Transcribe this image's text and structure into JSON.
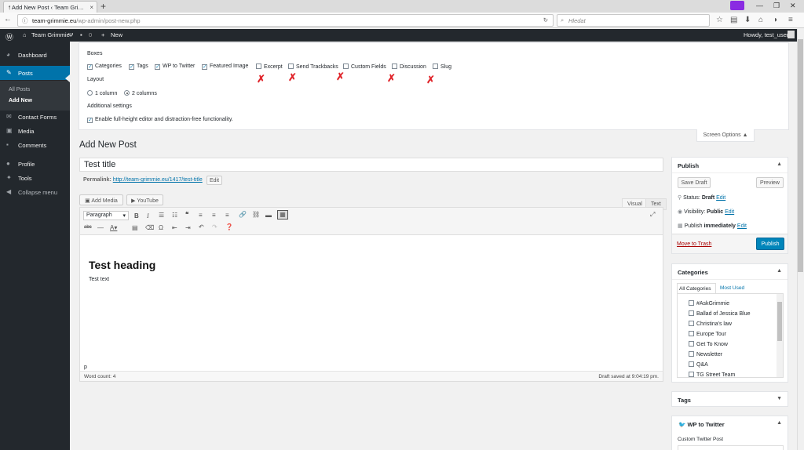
{
  "browser": {
    "tab_title": "Add New Post ‹ Team Gri…",
    "tab_close": "×",
    "new_tab": "+",
    "url_domain": "team-grimmie.eu",
    "url_path": "/wp-admin/post-new.php",
    "search_placeholder": "Hledat",
    "icons": [
      "back-icon",
      "info-icon",
      "reload-icon",
      "bookmark-star-icon",
      "reading-list-icon",
      "download-icon",
      "home-icon",
      "pocket-icon",
      "menu-icon",
      "private-mask-icon"
    ]
  },
  "admin_bar": {
    "site_name": "Team Grimmie",
    "comments_count": "0",
    "new_label": "New",
    "greeting": "Howdy, test_user"
  },
  "sidebar": {
    "items": [
      {
        "label": "Dashboard",
        "icon": "dashboard-icon"
      },
      {
        "label": "Posts",
        "icon": "pin-icon"
      },
      {
        "label": "Contact Forms",
        "icon": "mail-icon"
      },
      {
        "label": "Media",
        "icon": "media-icon"
      },
      {
        "label": "Comments",
        "icon": "comment-icon"
      },
      {
        "label": "Profile",
        "icon": "user-icon"
      },
      {
        "label": "Tools",
        "icon": "wrench-icon"
      },
      {
        "label": "Collapse menu",
        "icon": "collapse-icon"
      }
    ],
    "submenu": [
      "All Posts",
      "Add New"
    ]
  },
  "screen_options": {
    "boxes_heading": "Boxes",
    "boxes": [
      {
        "label": "Categories",
        "checked": true
      },
      {
        "label": "Tags",
        "checked": true
      },
      {
        "label": "WP to Twitter",
        "checked": true
      },
      {
        "label": "Featured Image",
        "checked": true
      },
      {
        "label": "Excerpt",
        "checked": false
      },
      {
        "label": "Send Trackbacks",
        "checked": false
      },
      {
        "label": "Custom Fields",
        "checked": false
      },
      {
        "label": "Discussion",
        "checked": false
      },
      {
        "label": "Slug",
        "checked": false
      }
    ],
    "layout_heading": "Layout",
    "layout_options": [
      {
        "label": "1 column",
        "selected": false
      },
      {
        "label": "2 columns",
        "selected": true
      }
    ],
    "additional_heading": "Additional settings",
    "additional_option": "Enable full-height editor and distraction-free functionality.",
    "tab_label": "Screen Options ▲",
    "annotation_color": "#e0242a"
  },
  "main": {
    "page_title": "Add New Post",
    "post_title": "Test title",
    "permalink_label": "Permalink:",
    "permalink_url": "http://team-grimmie.eu/1417/test-title",
    "edit_button": "Edit",
    "add_media": "Add Media",
    "youtube": "YouTube",
    "tab_visual": "Visual",
    "tab_text": "Text",
    "format_select": "Paragraph",
    "content_heading": "Test heading",
    "content_text": "Test text",
    "path": "p",
    "word_count": "Word count: 4",
    "draft_saved": "Draft saved at 9:04:19 pm."
  },
  "publish_box": {
    "title": "Publish",
    "save_draft": "Save Draft",
    "preview": "Preview",
    "status_label": "Status:",
    "status_value": "Draft",
    "visibility_label": "Visibility:",
    "visibility_value": "Public",
    "publish_label": "Publish",
    "publish_value": "immediately",
    "edit_link": "Edit",
    "move_to_trash": "Move to Trash",
    "publish_button": "Publish",
    "accent": "#0085ba"
  },
  "categories_box": {
    "title": "Categories",
    "tab_all": "All Categories",
    "tab_used": "Most Used",
    "items": [
      "#AskGrimmie",
      "Ballad of Jessica Blue",
      "Christina's law",
      "Europe Tour",
      "Get To Know",
      "Newsletter",
      "Q&A",
      "TG Street Team"
    ]
  },
  "tags_box": {
    "title": "Tags"
  },
  "twitter_box": {
    "title": "WP to Twitter",
    "field_label": "Custom Twitter Post"
  }
}
